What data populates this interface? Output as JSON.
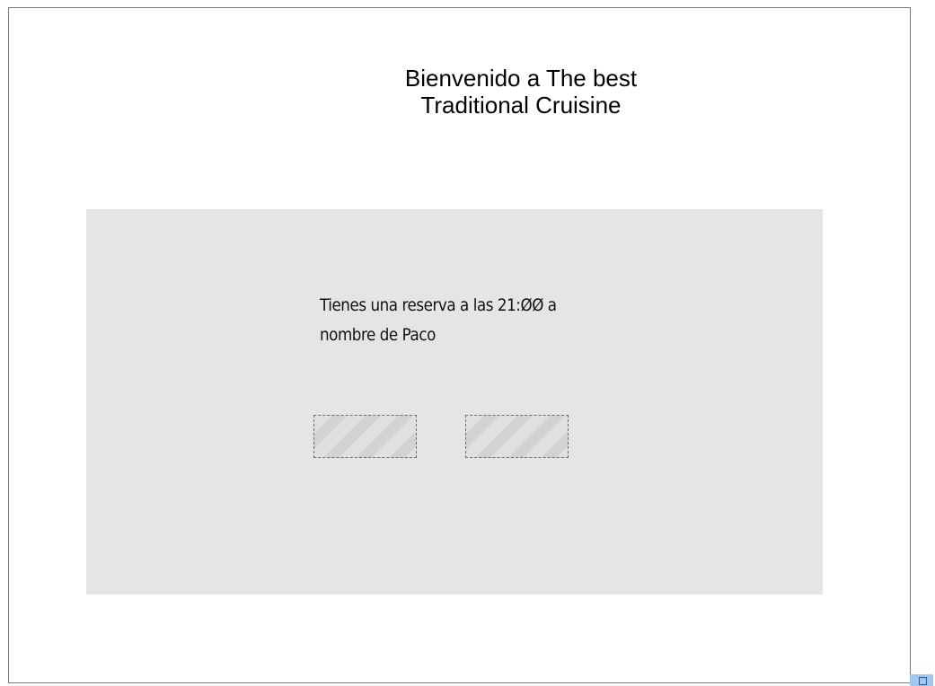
{
  "header": {
    "title": "Bienvenido a The best\nTraditional Cruisine"
  },
  "panel": {
    "message": "Tienes una reserva a  las  21:ØØ a nombre de Paco",
    "buttons": [
      {
        "label": ""
      },
      {
        "label": ""
      }
    ]
  },
  "icons": {
    "resize_handle": "resize-icon"
  },
  "colors": {
    "panel_background": "#e5e5e5",
    "frame_border": "#7a7a7a",
    "handle": "#9fc7ef"
  }
}
